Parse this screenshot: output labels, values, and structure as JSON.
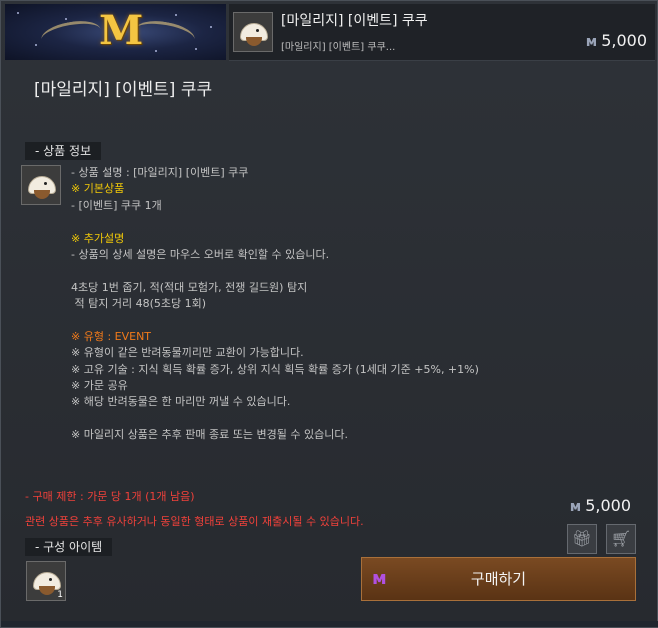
{
  "header": {
    "title": "[마일리지] [이벤트] 쿠쿠",
    "subtitle": "[마일리지] [이벤트] 쿠쿠...",
    "price": "5,000",
    "banner_letter": "M"
  },
  "main": {
    "title": "[마일리지] [이벤트] 쿠쿠",
    "product_info_label": "- 상품 정보",
    "components_label": "- 구성 아이템",
    "description_lines": [
      {
        "text": "- 상품 설명 : [마일리지] [이벤트] 쿠쿠",
        "tone": "plain"
      },
      {
        "text": "※ 기본상품",
        "tone": "yellow"
      },
      {
        "text": "- [이벤트] 쿠쿠 1개",
        "tone": "plain"
      },
      {
        "text": "",
        "tone": "plain"
      },
      {
        "text": "※ 추가설명",
        "tone": "yellow"
      },
      {
        "text": "- 상품의 상세 설명은 마우스 오버로 확인할 수 있습니다.",
        "tone": "plain"
      },
      {
        "text": "",
        "tone": "plain"
      },
      {
        "text": "4초당 1번 줍기, 적(적대 모험가, 전쟁 길드원) 탐지",
        "tone": "plain"
      },
      {
        "text": " 적 탐지 거리 48(5초당 1회)",
        "tone": "plain"
      },
      {
        "text": "",
        "tone": "plain"
      },
      {
        "text": "※ 유형 : EVENT",
        "tone": "orange"
      },
      {
        "text": "※ 유형이 같은 반려동물끼리만 교환이 가능합니다.",
        "tone": "plain"
      },
      {
        "text": "※ 고유 기술 : 지식 획득 확률 증가, 상위 지식 획득 확률 증가 (1세대 기준 +5%, +1%)",
        "tone": "plain"
      },
      {
        "text": "※ 가문 공유",
        "tone": "plain"
      },
      {
        "text": "※ 해당 반려동물은 한 마리만 꺼낼 수 있습니다.",
        "tone": "plain"
      },
      {
        "text": "",
        "tone": "plain"
      },
      {
        "text": "※ 마일리지 상품은 추후 판매 종료 또는 변경될 수 있습니다.",
        "tone": "plain"
      }
    ],
    "purchase_limit": "- 구매 제한 : 가문 당 1개 (1개 남음)",
    "notice": "관련 상품은 추후 유사하거나 동일한 형태로 상품이 재출시될 수 있습니다.",
    "price": "5,000",
    "component_qty": "1",
    "buy_label": "구매하기"
  },
  "icons": {
    "currency": "mileage-icon",
    "gift": "gift-icon",
    "cart": "cart-icon"
  },
  "colors": {
    "highlight_yellow": "#f0c808",
    "highlight_orange": "#f07a1a",
    "warning_red": "#f0413a",
    "mileage_purple": "#b050e0"
  }
}
